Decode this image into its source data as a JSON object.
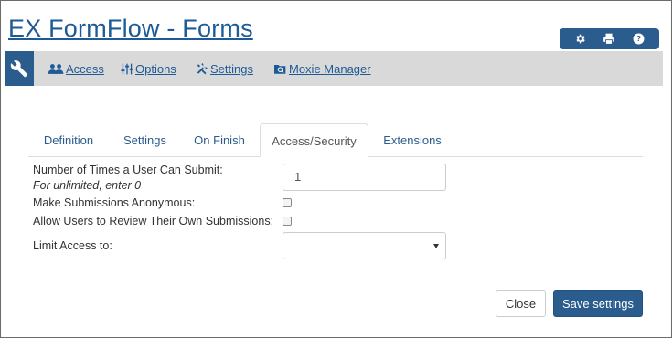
{
  "app": {
    "title": "EX FormFlow - Forms"
  },
  "toolbar": {
    "icons": [
      "gear-icon",
      "print-icon",
      "help-icon"
    ],
    "accent_color": "#2a5c8e"
  },
  "nav": {
    "items": [
      {
        "label": "Access",
        "icon": "users-icon"
      },
      {
        "label": "Options",
        "icon": "sliders-icon"
      },
      {
        "label": "Settings",
        "icon": "tools-icon"
      },
      {
        "label": "Moxie Manager",
        "icon": "folder-search-icon"
      }
    ]
  },
  "tabs": [
    {
      "label": "Definition",
      "active": false
    },
    {
      "label": "Settings",
      "active": false
    },
    {
      "label": "On Finish",
      "active": false
    },
    {
      "label": "Access/Security",
      "active": true
    },
    {
      "label": "Extensions",
      "active": false
    }
  ],
  "form": {
    "submit_limit": {
      "label": "Number of Times a User Can Submit:",
      "hint": "For unlimited, enter 0",
      "value": "1"
    },
    "anonymous": {
      "label": "Make Submissions Anonymous:",
      "checked": false
    },
    "review_own": {
      "label": "Allow Users to Review Their Own Submissions:",
      "checked": false
    },
    "limit_access": {
      "label": "Limit Access to:",
      "selected": ""
    }
  },
  "buttons": {
    "close": "Close",
    "save": "Save settings"
  }
}
